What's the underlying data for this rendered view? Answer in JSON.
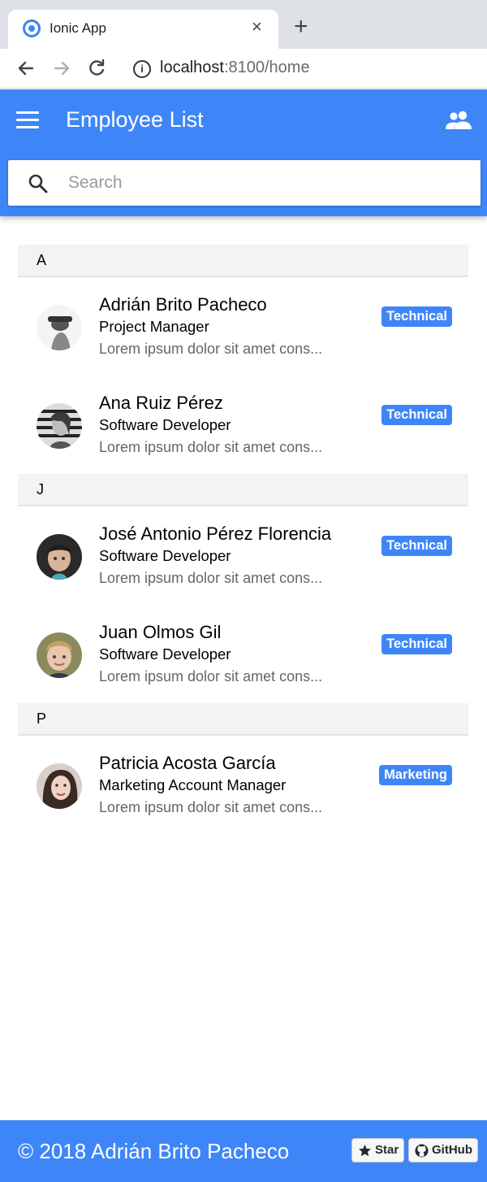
{
  "browser": {
    "tab_title": "Ionic App",
    "tab_close": "×",
    "new_tab": "+",
    "url_host": "localhost",
    "url_rest": ":8100/home"
  },
  "header": {
    "title": "Employee List",
    "search_placeholder": "Search",
    "accent_color": "#3e86f7"
  },
  "groups": [
    {
      "letter": "A",
      "employees": [
        {
          "name": "Adrián Brito Pacheco",
          "role": "Project Manager",
          "desc": "Lorem ipsum dolor sit amet cons...",
          "badge": "Technical"
        },
        {
          "name": "Ana Ruiz Pérez",
          "role": "Software Developer",
          "desc": "Lorem ipsum dolor sit amet cons...",
          "badge": "Technical"
        }
      ]
    },
    {
      "letter": "J",
      "employees": [
        {
          "name": "José Antonio Pérez Florencia",
          "role": "Software Developer",
          "desc": "Lorem ipsum dolor sit amet cons...",
          "badge": "Technical"
        },
        {
          "name": "Juan Olmos Gil",
          "role": "Software Developer",
          "desc": "Lorem ipsum dolor sit amet cons...",
          "badge": "Technical"
        }
      ]
    },
    {
      "letter": "P",
      "employees": [
        {
          "name": "Patricia Acosta García",
          "role": "Marketing Account Manager",
          "desc": "Lorem ipsum dolor sit amet cons...",
          "badge": "Marketing"
        }
      ]
    }
  ],
  "footer": {
    "text": "© 2018 Adrián Brito Pacheco",
    "star_label": "Star",
    "github_label": "GitHub"
  }
}
